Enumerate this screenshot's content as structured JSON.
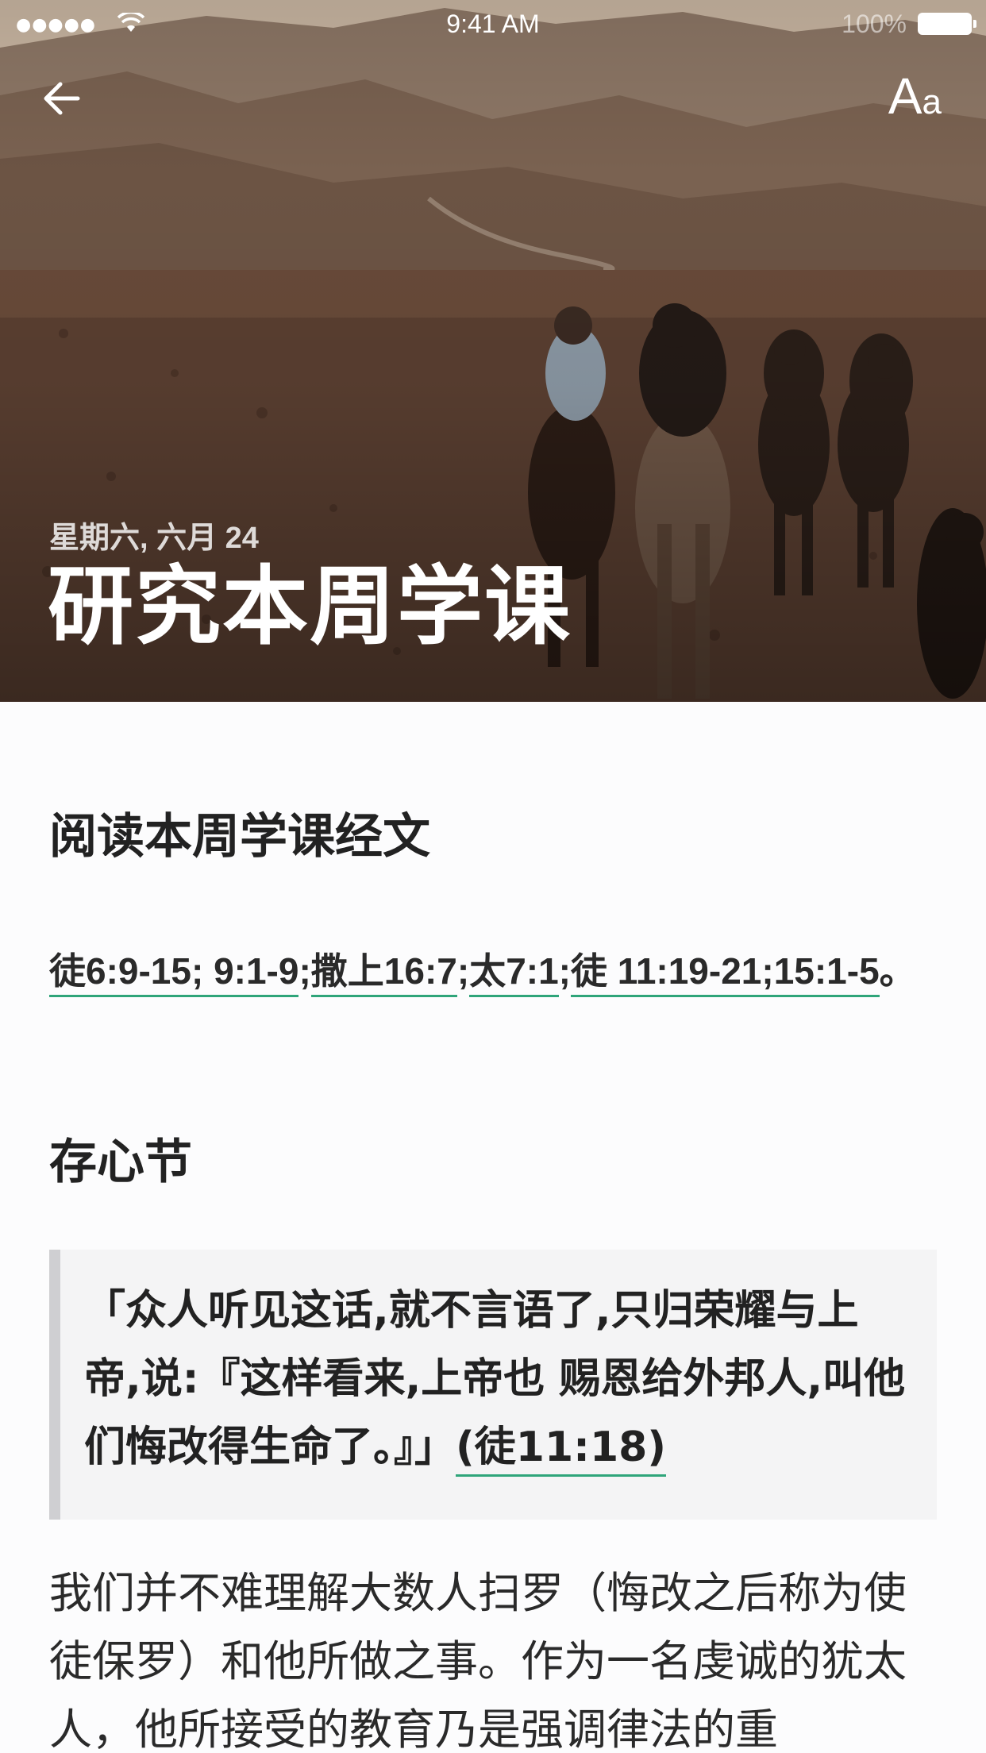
{
  "status_bar": {
    "time": "9:41 AM",
    "battery": "100%"
  },
  "nav": {
    "font_size_big": "A",
    "font_size_small": "a"
  },
  "hero": {
    "date": "星期六, 六月 24",
    "title": "研究本周学课"
  },
  "reading": {
    "heading": "阅读本周学课经文",
    "references": [
      {
        "label": "徒6:9-15; 9:1-9",
        "sep": ";"
      },
      {
        "label": "撒上16:7",
        "sep": ";"
      },
      {
        "label": "太7:1",
        "sep": ";"
      },
      {
        "label": "徒 11:19-21;15:1-5",
        "sep": "。"
      }
    ]
  },
  "memory": {
    "heading": "存心节",
    "text": "「众人听见这话,就不言语了,只归荣耀与上帝,说:『这样看来,上帝也 赐恩给外邦人,叫他们悔改得生命了。』」",
    "reference": "(徒11:18)"
  },
  "body": {
    "paragraph": "我们并不难理解大数人扫罗（悔改之后称为使徒保罗）和他所做之事。作为一名虔诚的犹太人，他所接受的教育乃是强调律法的重"
  },
  "colors": {
    "link_underline": "#2fa57a",
    "quote_bar": "#cfcfd2",
    "quote_bg": "#f4f4f5"
  }
}
